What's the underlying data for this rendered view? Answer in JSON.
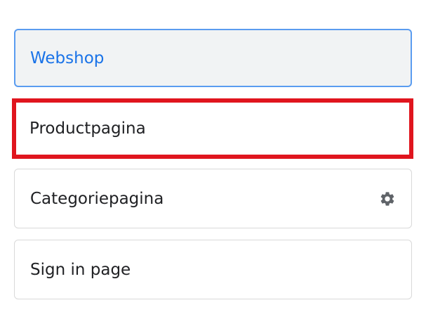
{
  "page_list": {
    "items": [
      {
        "label": "Webshop",
        "state": "selected"
      },
      {
        "label": "Productpagina",
        "state": "highlighted"
      },
      {
        "label": "Categoriepagina",
        "state": "default",
        "icon": "gear-icon"
      },
      {
        "label": "Sign in page",
        "state": "default"
      }
    ]
  },
  "colors": {
    "selected_text": "#1a73e8",
    "selected_border": "#5a9cf0",
    "selected_bg": "#f1f3f4",
    "highlight_border": "#e0151e",
    "default_border": "#d9d9d9",
    "icon": "#5f6368"
  }
}
